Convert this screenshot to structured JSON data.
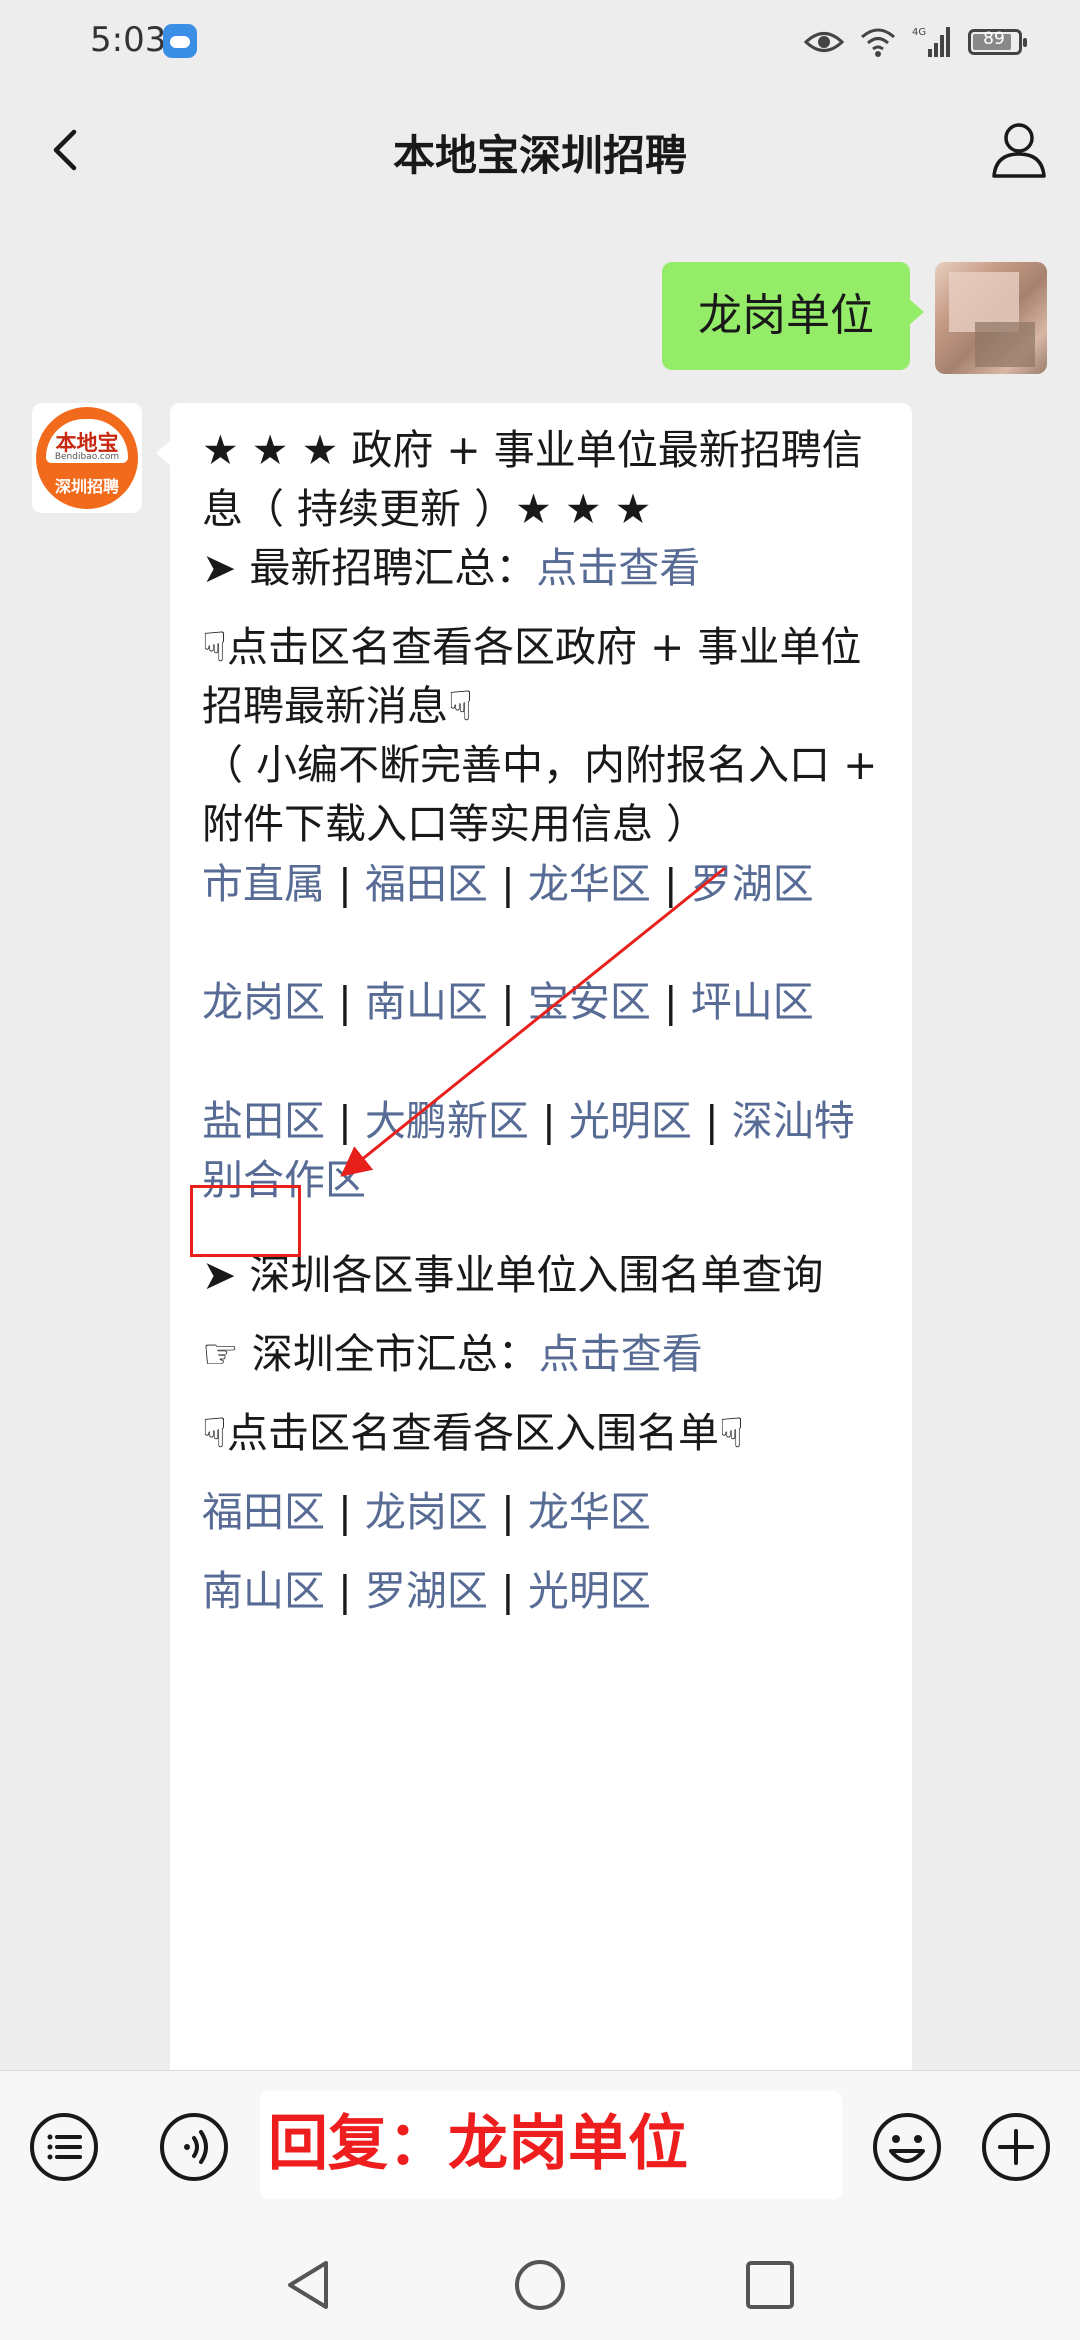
{
  "status": {
    "time": "5:03",
    "network": "4G",
    "battery": "89"
  },
  "header": {
    "title": "本地宝深圳招聘"
  },
  "chat": {
    "user_message": "龙岗单位",
    "bot_logo": {
      "top": "本地宝",
      "mid": "Bendibao.com",
      "bottom": "深圳招聘"
    },
    "reply": {
      "title": "★ ★ ★ 政府 + 事业单位最新招聘信息（ 持续更新 ）★ ★ ★",
      "summary_prefix": "➤ 最新招聘汇总：",
      "summary_link": "点击查看",
      "district_intro": "☟点击区名查看各区政府 + 事业单位招聘最新消息☟",
      "note": "（ 小编不断完善中，内附报名入口 + 附件下载入口等实用信息 ）",
      "districts_row1": [
        "市直属",
        "福田区",
        "龙华区",
        "罗湖区"
      ],
      "districts_row2": [
        "龙岗区",
        "南山区",
        "宝安区",
        "坪山区"
      ],
      "districts_row3": [
        "盐田区",
        "大鹏新区",
        "光明区",
        "深汕特别合作区"
      ],
      "shortlist_title": "➤ 深圳各区事业单位入围名单查询",
      "citywide_prefix": "☞ 深圳全市汇总：",
      "citywide_link": "点击查看",
      "shortlist_intro": "☟点击区名查看各区入围名单☟",
      "shortlist_row1": [
        "福田区",
        "龙岗区",
        "龙华区"
      ],
      "shortlist_row2": [
        "南山区",
        "罗湖区",
        "光明区"
      ],
      "separator": "|"
    }
  },
  "input": {
    "text": "回复：龙岗单位"
  },
  "colors": {
    "link": "#576b95",
    "user_bubble": "#95ec69",
    "highlight": "#e8201c"
  }
}
